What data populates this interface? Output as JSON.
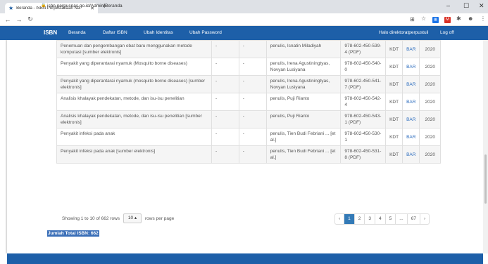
{
  "browser": {
    "tab_title": "Beranda - ISBN Perpustakaan Na",
    "url": "isbn.perpusnas.go.id/Admin/Beranda"
  },
  "navbar": {
    "brand": "ISBN",
    "links": [
      "Beranda",
      "Daftar ISBN",
      "Ubah Identitas",
      "Ubah Password"
    ],
    "greeting": "Halo direktoratperpustuil",
    "logoff": "Log off"
  },
  "table": {
    "rows": [
      {
        "title": "Penemuan dan pengembangan obat baru menggunakan metode komputasi [sumber elektronis]",
        "col2": "-",
        "col3": "-",
        "author": "penulis, Isnatin Miladiyah",
        "isbn": "978-602-450-539-4 (PDF)",
        "kdt": "KDT",
        "bar": "BAR",
        "year": "2020"
      },
      {
        "title": "Penyakit yang diperantarai nyamuk (Mosquito borne diseases)",
        "col2": "-",
        "col3": "-",
        "author": "penulis, Irena Agustiningtyas, Novyan Lusiyana",
        "isbn": "978-602-450-540-0",
        "kdt": "KDT",
        "bar": "BAR",
        "year": "2020"
      },
      {
        "title": "Penyakit yang diperantarai nyamuk (mosquito borne diseases) [sumber elektronis]",
        "col2": "-",
        "col3": "-",
        "author": "penulis, Irena Agustiningtyas, Novyan Lusiyana",
        "isbn": "978-602-450-541-7 (PDF)",
        "kdt": "KDT",
        "bar": "BAR",
        "year": "2020"
      },
      {
        "title": "Analisis khalayak pendekatan, metode, dan isu-isu penelitian",
        "col2": "-",
        "col3": "-",
        "author": "penulis, Puji Rianto",
        "isbn": "978-602-450-542-4",
        "kdt": "KDT",
        "bar": "BAR",
        "year": "2020"
      },
      {
        "title": "Analisis khalayak pendekatan, metode, dan isu-isu penelitian [sumber elektronis]",
        "col2": "-",
        "col3": "-",
        "author": "penulis, Puji Rianto",
        "isbn": "978-602-450-543-1 (PDF)",
        "kdt": "KDT",
        "bar": "BAR",
        "year": "2020"
      },
      {
        "title": "Penyakit infeksi pada anak",
        "col2": "-",
        "col3": "-",
        "author": "penulis, Tien Budi Febriani ... [et al.]",
        "isbn": "978-602-450-530-1",
        "kdt": "KDT",
        "bar": "BAR",
        "year": "2020"
      },
      {
        "title": "Penyakit infeksi pada anak [sumber elektronis]",
        "col2": "-",
        "col3": "-",
        "author": "penulis, Tien Budi Febriani ... [et al.]",
        "isbn": "978-602-450-531-8 (PDF)",
        "kdt": "KDT",
        "bar": "BAR",
        "year": "2020"
      }
    ]
  },
  "footer": {
    "showing": "Showing 1 to 10 of 662 rows",
    "page_size": "10",
    "per_page": "rows per page",
    "pager": [
      "‹",
      "1",
      "2",
      "3",
      "4",
      "5",
      "...",
      "67",
      "›"
    ],
    "active_page": "1",
    "total": "Jumlah Total ISBN: 662"
  }
}
